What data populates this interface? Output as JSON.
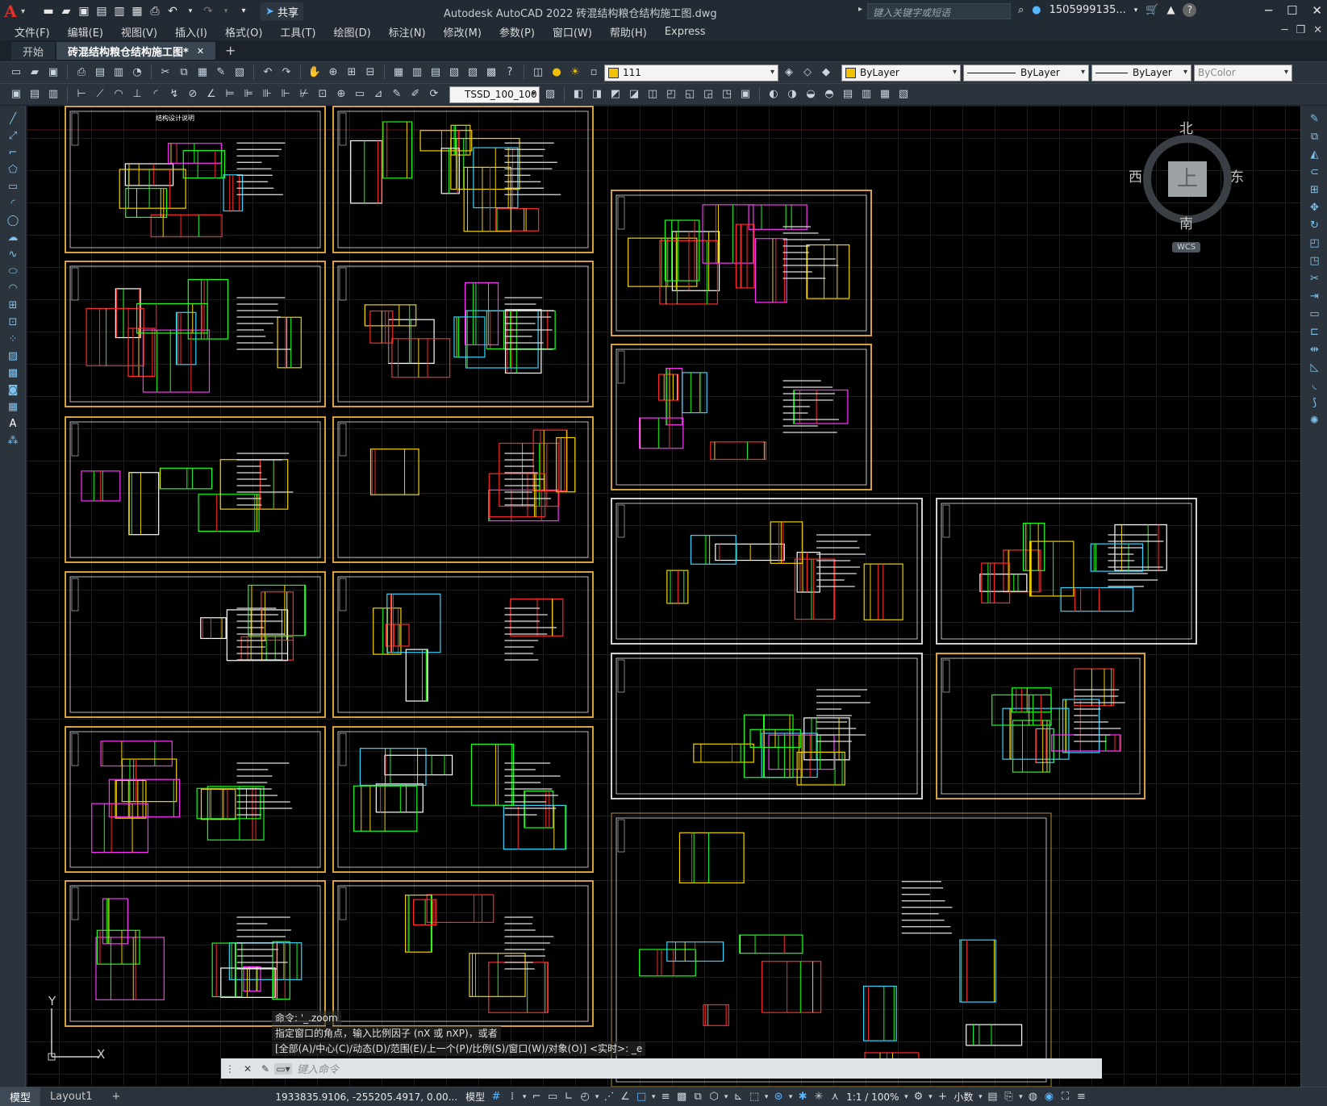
{
  "window": {
    "title": "Autodesk AutoCAD 2022    砖混结构粮仓结构施工图.dwg",
    "logo": "A",
    "share_label": "共享",
    "search_placeholder": "键入关键字或短语",
    "user": "1505999135...",
    "colors": {
      "accent": "#d4a13a",
      "canvas": "#000000",
      "chrome": "#2b333d"
    }
  },
  "menu": {
    "items": [
      "文件(F)",
      "编辑(E)",
      "视图(V)",
      "插入(I)",
      "格式(O)",
      "工具(T)",
      "绘图(D)",
      "标注(N)",
      "修改(M)",
      "参数(P)",
      "窗口(W)",
      "帮助(H)",
      "Express"
    ]
  },
  "tabs": {
    "start": "开始",
    "active": "砖混结构粮仓结构施工图*"
  },
  "toolbar": {
    "layer_value": "111",
    "color_value": "ByLayer",
    "linetype_value": "ByLayer",
    "lineweight_value": "ByLayer",
    "plotstyle_value": "ByColor",
    "dimstyle_value": "TSSD_100_100"
  },
  "viewcube": {
    "north": "北",
    "south": "南",
    "east": "东",
    "west": "西",
    "top": "上",
    "wcs": "WCS"
  },
  "ucs": {
    "y": "Y",
    "x": "X"
  },
  "command": {
    "history": [
      "命令: '_.zoom",
      "指定窗口的角点，输入比例因子 (nX 或 nXP)，或者",
      "[全部(A)/中心(C)/动态(D)/范围(E)/上一个(P)/比例(S)/窗口(W)/对象(O)] <实时>: _e"
    ],
    "placeholder": "键入命令"
  },
  "status": {
    "model_tab": "模型",
    "layout_tab": "Layout1",
    "coordinates": "1933835.9106, -255205.4917, 0.00...",
    "space": "模型",
    "scale": "1:1 / 100%",
    "units": "小数"
  },
  "sheets": {
    "title_text": "结构设计说明"
  }
}
